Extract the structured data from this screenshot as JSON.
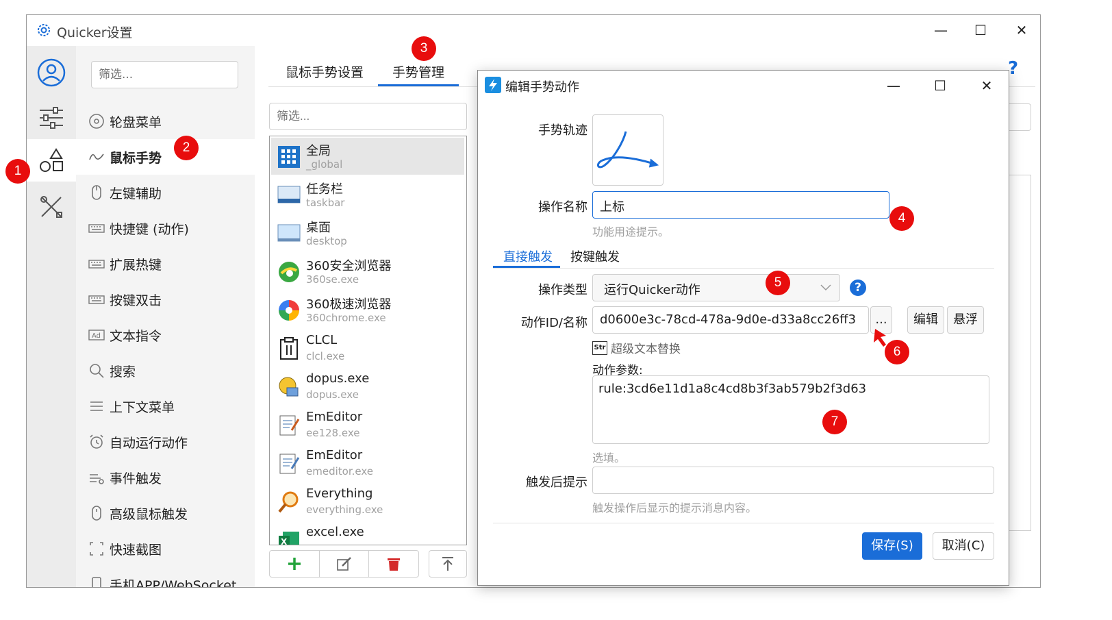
{
  "window": {
    "title": "Quicker设置"
  },
  "colors": {
    "accent": "#1a6dd8",
    "badge": "#e80d0d"
  },
  "sidebar": {
    "filter_placeholder": "筛选...",
    "items": [
      {
        "label": "轮盘菜单",
        "icon": "wheel-icon"
      },
      {
        "label": "鼠标手势",
        "icon": "gesture-icon"
      },
      {
        "label": "左键辅助",
        "icon": "mouse-icon"
      },
      {
        "label": "快捷键 (动作)",
        "icon": "keyboard-icon"
      },
      {
        "label": "扩展热键",
        "icon": "keyboard-icon"
      },
      {
        "label": "按键双击",
        "icon": "keyboard-icon"
      },
      {
        "label": "文本指令",
        "icon": "ad-icon"
      },
      {
        "label": "搜索",
        "icon": "search-icon"
      },
      {
        "label": "上下文菜单",
        "icon": "menu-icon"
      },
      {
        "label": "自动运行动作",
        "icon": "alarm-icon"
      },
      {
        "label": "事件触发",
        "icon": "event-icon"
      },
      {
        "label": "高级鼠标触发",
        "icon": "mouse-icon"
      },
      {
        "label": "快速截图",
        "icon": "screenshot-icon"
      },
      {
        "label": "手机APP/WebSocket",
        "icon": "phone-icon"
      }
    ]
  },
  "tabs": {
    "mouse_gesture_settings": "鼠标手势设置",
    "gesture_management": "手势管理"
  },
  "app_list": {
    "filter_placeholder": "筛选...",
    "items": [
      {
        "name": "全局",
        "sub": "_global",
        "icon": "grid-icon"
      },
      {
        "name": "任务栏",
        "sub": "taskbar",
        "icon": "taskbar-icon"
      },
      {
        "name": "桌面",
        "sub": "desktop",
        "icon": "desktop-icon"
      },
      {
        "name": "360安全浏览器",
        "sub": "360se.exe",
        "icon": "360se-icon"
      },
      {
        "name": "360极速浏览器",
        "sub": "360chrome.exe",
        "icon": "360chrome-icon"
      },
      {
        "name": "CLCL",
        "sub": "clcl.exe",
        "icon": "clipboard-icon"
      },
      {
        "name": "dopus.exe",
        "sub": "dopus.exe",
        "icon": "dopus-icon"
      },
      {
        "name": "EmEditor",
        "sub": "ee128.exe",
        "icon": "notepad-icon"
      },
      {
        "name": "EmEditor",
        "sub": "emeditor.exe",
        "icon": "notepad-icon"
      },
      {
        "name": "Everything",
        "sub": "everything.exe",
        "icon": "magnifier-icon"
      },
      {
        "name": "excel.exe",
        "sub": "",
        "icon": "excel-icon"
      }
    ]
  },
  "dialog": {
    "title": "编辑手势动作",
    "gesture_label": "手势轨迹",
    "action_name_label": "操作名称",
    "action_name_value": "上标",
    "action_name_hint": "功能用途提示。",
    "subtab_direct": "直接触发",
    "subtab_key": "按键触发",
    "action_type_label": "操作类型",
    "action_type_value": "运行Quicker动作",
    "action_id_label": "动作ID/名称",
    "action_id_value": "d0600e3c-78cd-478a-9d0e-d33a8cc26ff3",
    "browse_btn": "...",
    "edit_btn": "编辑",
    "float_btn": "悬浮",
    "str_icon_text": "Str",
    "super_text_replace": "超级文本替换",
    "params_label": "动作参数:",
    "params_value": "rule:3cd6e11d1a8c4cd8b3f3ab579b2f3d63",
    "params_hint": "选填。",
    "after_label": "触发后提示",
    "after_value": "",
    "after_hint": "触发操作后显示的提示消息内容。",
    "save_btn": "保存(S)",
    "cancel_btn": "取消(C)"
  },
  "badges": [
    "1",
    "2",
    "3",
    "4",
    "5",
    "6",
    "7"
  ]
}
